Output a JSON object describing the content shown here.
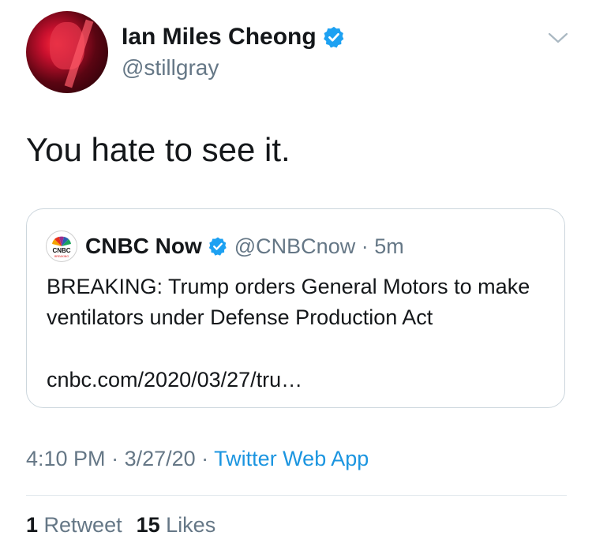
{
  "author": {
    "name": "Ian Miles Cheong",
    "handle": "@stillgray",
    "verified": true
  },
  "tweet": {
    "text": "You hate to see it."
  },
  "quoted": {
    "name": "CNBC Now",
    "handle": "@CNBCnow",
    "separator": " · ",
    "time": "5m",
    "verified": true,
    "body": "BREAKING: Trump orders General Motors to make ventilators under Defense Production Act",
    "link": "cnbc.com/2020/03/27/tru…",
    "logo_text": "CNBC",
    "logo_subtext": "BREAKING"
  },
  "meta": {
    "time": "4:10 PM",
    "sep1": " · ",
    "date": "3/27/20",
    "sep2": " · ",
    "source": "Twitter Web App"
  },
  "stats": {
    "retweets_count": "1",
    "retweets_label": "Retweet",
    "likes_count": "15",
    "likes_label": "Likes"
  },
  "colors": {
    "accent": "#1b95e0",
    "secondary_text": "#657786",
    "border": "#ccd6dd"
  },
  "icons": {
    "verified": "verified-badge-icon",
    "menu": "chevron-down-icon"
  }
}
